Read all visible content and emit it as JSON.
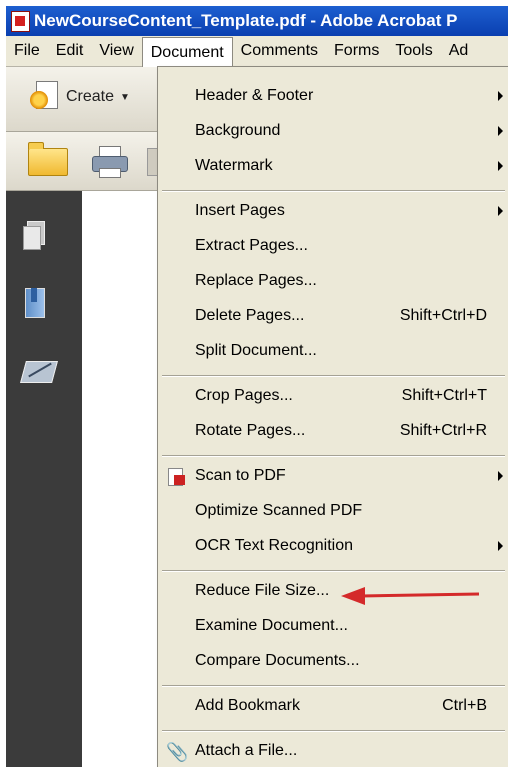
{
  "window": {
    "title": "NewCourseContent_Template.pdf - Adobe Acrobat P"
  },
  "menubar": {
    "items": [
      {
        "label": "File"
      },
      {
        "label": "Edit"
      },
      {
        "label": "View"
      },
      {
        "label": "Document"
      },
      {
        "label": "Comments"
      },
      {
        "label": "Forms"
      },
      {
        "label": "Tools"
      },
      {
        "label": "Ad"
      }
    ],
    "active": "Document"
  },
  "toolbar": {
    "create_label": "Create"
  },
  "document_menu": {
    "items": [
      {
        "label": "Header & Footer",
        "shortcut": "",
        "submenu": true
      },
      {
        "label": "Background",
        "shortcut": "",
        "submenu": true
      },
      {
        "label": "Watermark",
        "shortcut": "",
        "submenu": true
      },
      {
        "label": "Insert Pages",
        "shortcut": "",
        "submenu": true
      },
      {
        "label": "Extract Pages...",
        "shortcut": ""
      },
      {
        "label": "Replace Pages...",
        "shortcut": ""
      },
      {
        "label": "Delete Pages...",
        "shortcut": "Shift+Ctrl+D"
      },
      {
        "label": "Split Document...",
        "shortcut": ""
      },
      {
        "label": "Crop Pages...",
        "shortcut": "Shift+Ctrl+T"
      },
      {
        "label": "Rotate Pages...",
        "shortcut": "Shift+Ctrl+R"
      },
      {
        "label": "Scan to PDF",
        "shortcut": "",
        "submenu": true,
        "icon": "scan-pdf-icon"
      },
      {
        "label": "Optimize Scanned PDF",
        "shortcut": ""
      },
      {
        "label": "OCR Text Recognition",
        "shortcut": "",
        "submenu": true
      },
      {
        "label": "Reduce File Size...",
        "shortcut": ""
      },
      {
        "label": "Examine Document...",
        "shortcut": ""
      },
      {
        "label": "Compare Documents...",
        "shortcut": ""
      },
      {
        "label": "Add Bookmark",
        "shortcut": "Ctrl+B"
      },
      {
        "label": "Attach a File...",
        "shortcut": "",
        "icon": "paperclip-icon"
      }
    ]
  },
  "annotation": {
    "color": "#d42a2a",
    "points_to": "Reduce File Size..."
  },
  "colors": {
    "titlebar": "#0a3fb0",
    "menu_bg": "#ece9d8",
    "nav_panel": "#3b3b3b"
  }
}
